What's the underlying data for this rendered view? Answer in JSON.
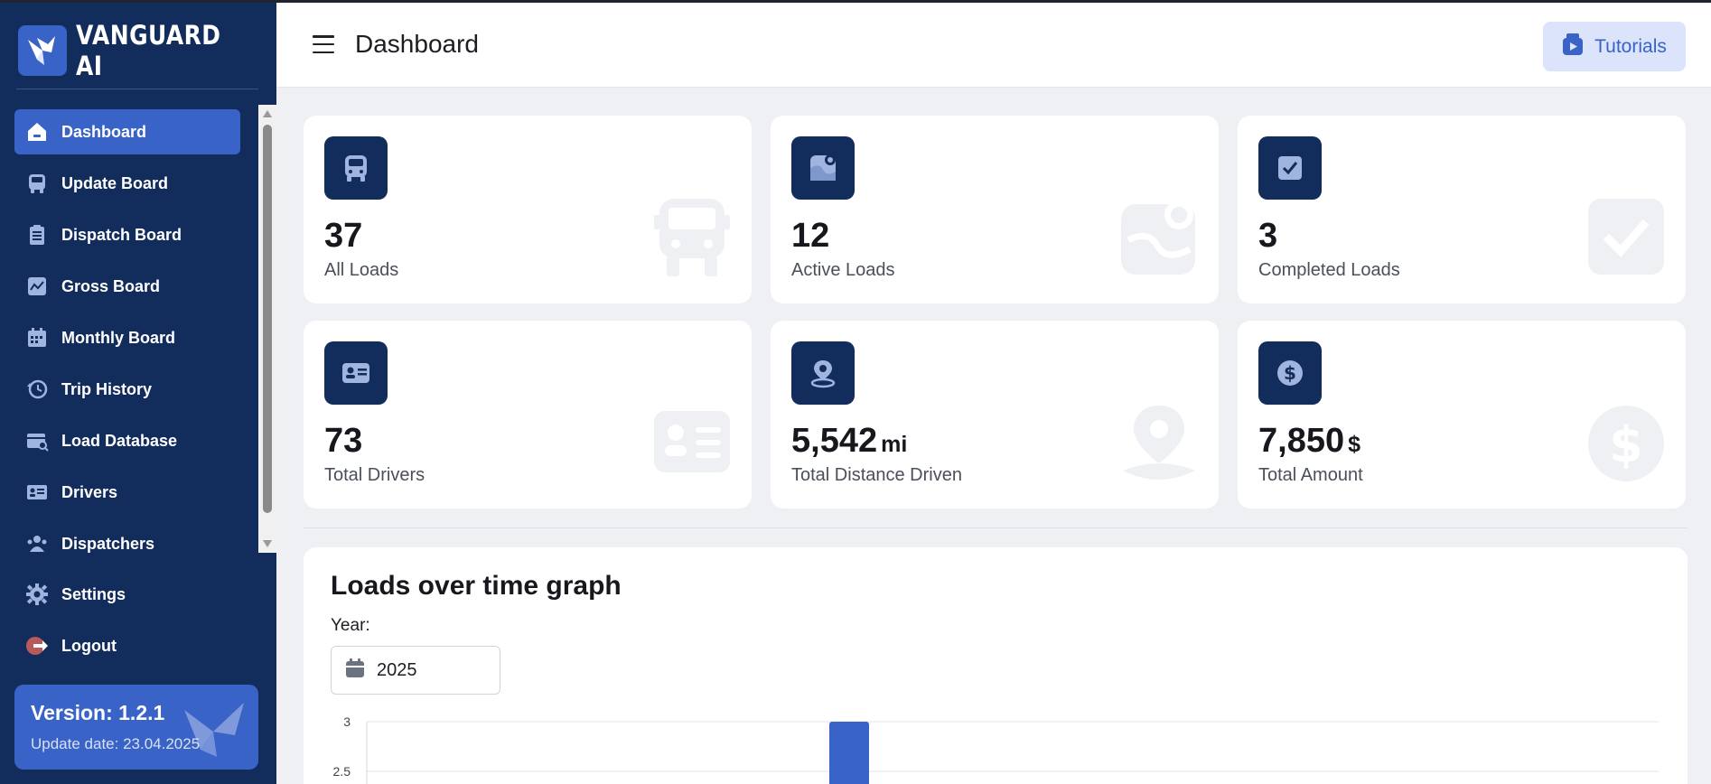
{
  "brand": {
    "name": "VANGUARD AI"
  },
  "sidebar": {
    "items": [
      {
        "label": "Dashboard",
        "icon": "home-icon",
        "active": true
      },
      {
        "label": "Update Board",
        "icon": "bus-icon"
      },
      {
        "label": "Dispatch Board",
        "icon": "clipboard-icon"
      },
      {
        "label": "Gross Board",
        "icon": "chart-line-icon"
      },
      {
        "label": "Monthly Board",
        "icon": "calendar-icon"
      },
      {
        "label": "Trip History",
        "icon": "history-icon"
      },
      {
        "label": "Load Database",
        "icon": "database-search-icon"
      },
      {
        "label": "Drivers",
        "icon": "id-card-icon"
      },
      {
        "label": "Dispatchers",
        "icon": "users-icon"
      }
    ],
    "settings_label": "Settings",
    "logout_label": "Logout",
    "version": {
      "title": "Version: 1.2.1",
      "update_date": "Update date: 23.04.2025"
    }
  },
  "header": {
    "title": "Dashboard",
    "tutorials_label": "Tutorials"
  },
  "stats": [
    {
      "value": "37",
      "unit": "",
      "label": "All Loads",
      "icon": "bus-icon"
    },
    {
      "value": "12",
      "unit": "",
      "label": "Active Loads",
      "icon": "map-pin-icon"
    },
    {
      "value": "3",
      "unit": "",
      "label": "Completed Loads",
      "icon": "check-square-icon"
    },
    {
      "value": "73",
      "unit": "",
      "label": "Total Drivers",
      "icon": "id-card-icon"
    },
    {
      "value": "5,542",
      "unit": "mi",
      "label": "Total Distance Driven",
      "icon": "location-icon"
    },
    {
      "value": "7,850",
      "unit": "$",
      "label": "Total Amount",
      "icon": "dollar-icon"
    }
  ],
  "loads_chart": {
    "title": "Loads over time graph",
    "year_label": "Year:",
    "year_value": "2025"
  },
  "colors": {
    "sidebar_bg": "#122c5b",
    "accent": "#3a63c7",
    "page_bg": "#eef0f4"
  },
  "chart_data": {
    "type": "bar",
    "title": "Loads over time graph",
    "xlabel": "",
    "ylabel": "",
    "y_ticks": [
      "3",
      "2.5"
    ],
    "ylim": [
      0,
      3
    ],
    "visible_bar_value": 3,
    "grid": true
  }
}
